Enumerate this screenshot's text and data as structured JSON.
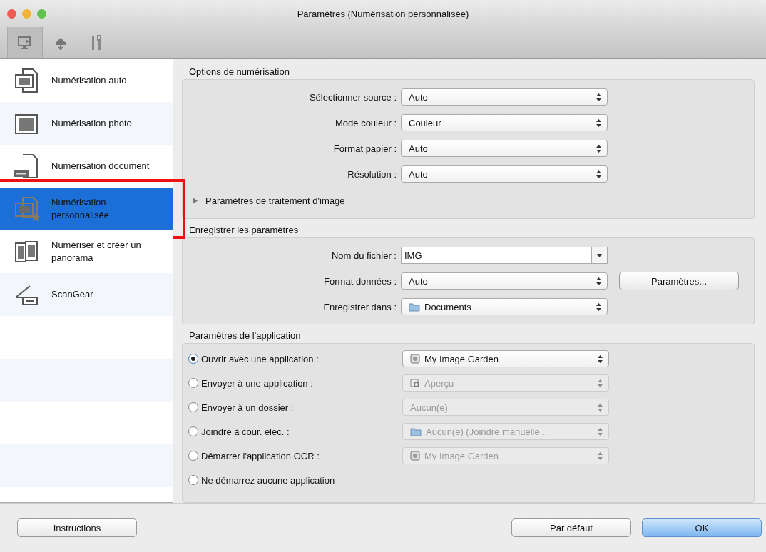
{
  "window": {
    "title": "Paramètres (Numérisation personnalisée)"
  },
  "toolbar": [
    {
      "kind": "scan",
      "selected": true
    },
    {
      "kind": "general",
      "selected": false
    },
    {
      "kind": "tools",
      "selected": false
    }
  ],
  "sidebar": {
    "items": [
      {
        "kind": "auto",
        "label": "Numérisation auto",
        "selected": false,
        "highlighted": false
      },
      {
        "kind": "photo",
        "label": "Numérisation photo",
        "selected": false,
        "highlighted": false
      },
      {
        "kind": "document",
        "label": "Numérisation document",
        "selected": false,
        "highlighted": false
      },
      {
        "kind": "custom",
        "label": "Numérisation personnalisée",
        "selected": true,
        "highlighted": true
      },
      {
        "kind": "panorama",
        "label": "Numériser et créer un panorama",
        "selected": false,
        "highlighted": false
      },
      {
        "kind": "scangear",
        "label": "ScanGear",
        "selected": false,
        "highlighted": false
      }
    ]
  },
  "scan_options": {
    "title": "Options de numérisation",
    "fields": [
      {
        "label": "Sélectionner source :",
        "value": "Auto"
      },
      {
        "label": "Mode couleur :",
        "value": "Couleur"
      },
      {
        "label": "Format papier :",
        "value": "Auto"
      },
      {
        "label": "Résolution :",
        "value": "Auto"
      }
    ],
    "disclosure": {
      "label": "Paramètres de traitement d'image",
      "expanded": false
    }
  },
  "save_settings": {
    "title": "Enregistrer les paramètres",
    "fields": [
      {
        "label": "Nom du fichier :",
        "value": "IMG",
        "kind": "combo"
      },
      {
        "label": "Format données :",
        "value": "Auto",
        "kind": "plain",
        "button": "Paramètres..."
      },
      {
        "label": "Enregistrer dans :",
        "value": "Documents",
        "kind": "folder"
      }
    ]
  },
  "app_settings": {
    "title": "Paramètres de l'application",
    "options": [
      {
        "label": "Ouvrir avec une application :",
        "selected": true,
        "select": {
          "value": "My Image Garden",
          "kind": "app",
          "disabled": false
        }
      },
      {
        "label": "Envoyer à une application :",
        "selected": false,
        "select": {
          "value": "Aperçu",
          "kind": "preview",
          "disabled": true
        }
      },
      {
        "label": "Envoyer à un dossier :",
        "selected": false,
        "select": {
          "value": "Aucun(e)",
          "kind": "plain",
          "disabled": true
        }
      },
      {
        "label": "Joindre à cour. élec. :",
        "selected": false,
        "select": {
          "value": "Aucun(e) (Joindre manuelle...",
          "kind": "folder",
          "disabled": true
        }
      },
      {
        "label": "Démarrer l'application OCR :",
        "selected": false,
        "select": {
          "value": "My Image Garden",
          "kind": "app",
          "disabled": true
        }
      },
      {
        "label": "Ne démarrez aucune application",
        "selected": false
      }
    ]
  },
  "footer": {
    "instructions": "Instructions",
    "defaults": "Par défaut",
    "ok": "OK"
  }
}
